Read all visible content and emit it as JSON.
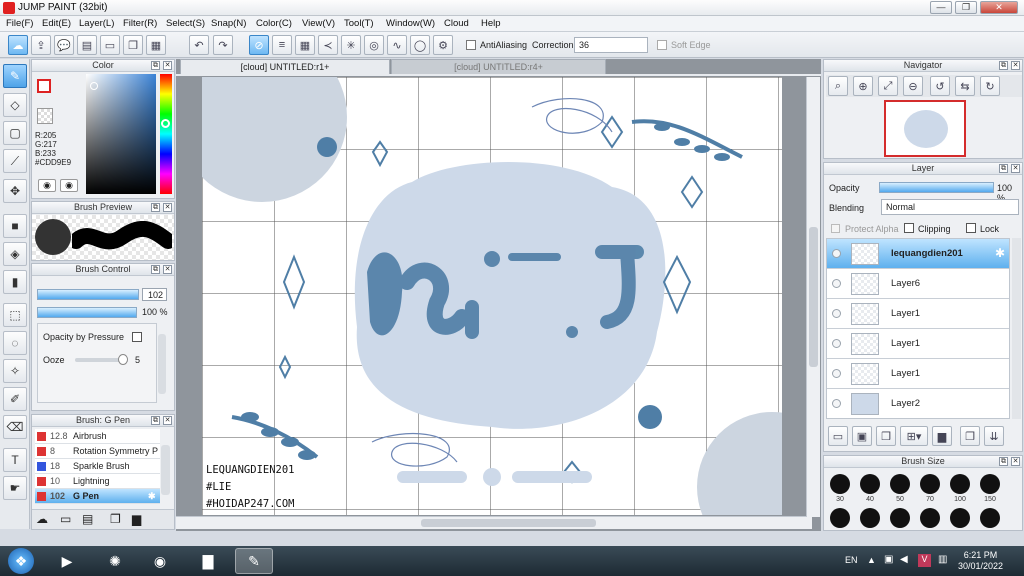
{
  "window": {
    "title": "JUMP PAINT (32bit)",
    "min": "—",
    "max": "❐",
    "close": "✕"
  },
  "menu": [
    "File(F)",
    "Edit(E)",
    "Layer(L)",
    "Filter(R)",
    "Select(S)",
    "Snap(N)",
    "Color(C)",
    "View(V)",
    "Tool(T)",
    "Window(W)",
    "Cloud",
    "Help"
  ],
  "toolbar": {
    "antialias_label": "AntiAliasing",
    "correction_label": "Correction",
    "correction_value": "36",
    "softedge_label": "Soft Edge"
  },
  "color_panel": {
    "title": "Color",
    "r": "R:205",
    "g": "G:217",
    "b": "B:233",
    "hex": "#CDD9E9",
    "current_color": "#cdd9e9"
  },
  "brush_preview": {
    "title": "Brush Preview"
  },
  "brush_control": {
    "title": "Brush Control",
    "size": "102",
    "opacity": "100 %",
    "opacity_pressure_label": "Opacity by Pressure",
    "ooze_label": "Ooze",
    "ooze_value": "5"
  },
  "brush_list": {
    "title": "Brush: G Pen",
    "items": [
      {
        "size": "12.8",
        "name": "Airbrush",
        "color": "#d33"
      },
      {
        "size": "8",
        "name": "Rotation Symmetry P",
        "color": "#d33"
      },
      {
        "size": "18",
        "name": "Sparkle Brush",
        "color": "#3355dd"
      },
      {
        "size": "10",
        "name": "Lightning",
        "color": "#d33"
      },
      {
        "size": "102",
        "name": "G Pen",
        "color": "#d33"
      }
    ]
  },
  "tabs": {
    "active": "[cloud] UNTITLED:r1+",
    "inactive": "[cloud] UNTITLED:r4+"
  },
  "artwork": {
    "watermark_1": "LEQUANGDIEN201",
    "watermark_2": "#LIE",
    "watermark_3": "#HOIDAP247.COM",
    "center_text": "ᵭᵴᵻ ᴊ"
  },
  "navigator": {
    "title": "Navigator"
  },
  "layer_panel": {
    "title": "Layer",
    "opacity_label": "Opacity",
    "opacity_value": "100 %",
    "blending_label": "Blending",
    "blending_value": "Normal",
    "protect_alpha": "Protect Alpha",
    "clipping": "Clipping",
    "lock": "Lock",
    "layers": [
      "lequangdien201",
      "Layer6",
      "Layer1",
      "Layer1",
      "Layer1",
      "Layer2"
    ]
  },
  "brush_size": {
    "title": "Brush Size",
    "sizes": [
      "30",
      "40",
      "50",
      "70",
      "100",
      "150"
    ]
  },
  "taskbar": {
    "lang": "EN",
    "time": "6:21 PM",
    "date": "30/01/2022"
  },
  "colors": {
    "accent": "#3c8fd8",
    "art_blue": "#4f7ea6",
    "art_pale": "#cdd9e9"
  }
}
